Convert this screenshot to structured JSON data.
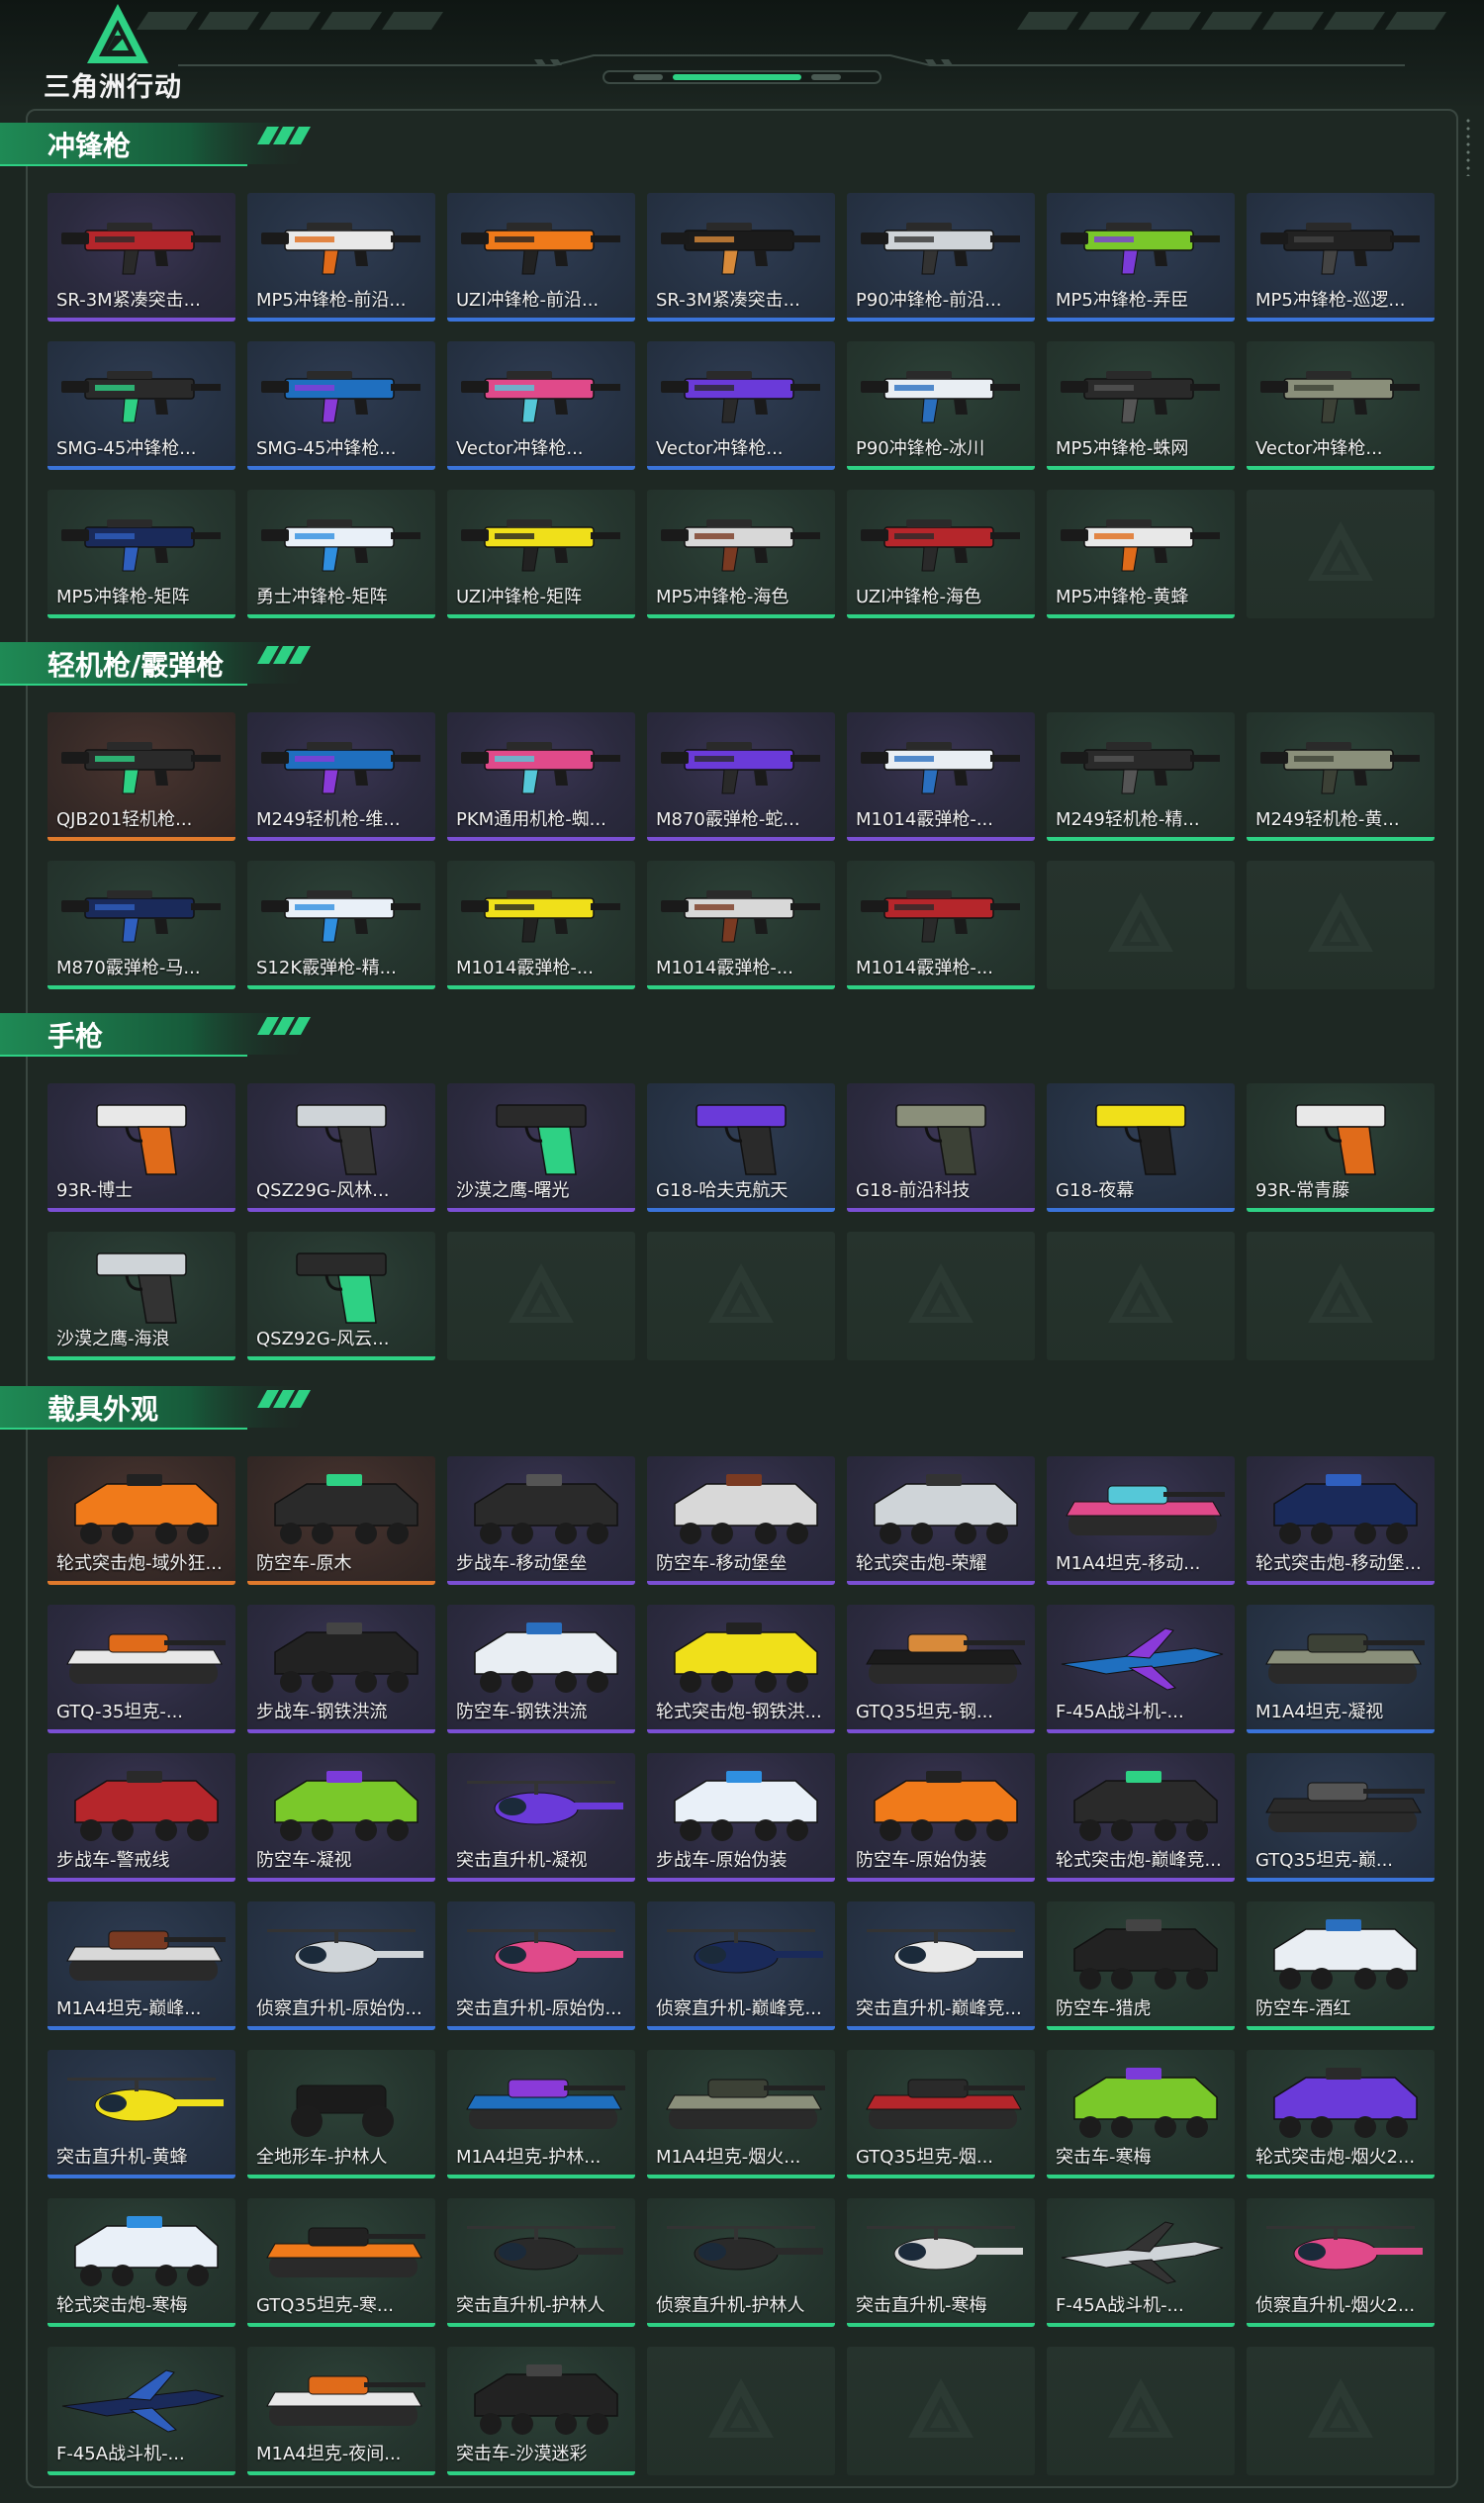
{
  "app": {
    "logo_text": "三角洲行动",
    "logo_icon": "triangle-delta-icon",
    "colors": {
      "accent_green": "#2ed184",
      "rarity_purple": "#7a4fd3",
      "rarity_blue": "#3a73d9",
      "rarity_green": "#2ed184",
      "rarity_orange": "#e07a2c"
    }
  },
  "sections": [
    {
      "title": "冲锋枪",
      "kind": "gun",
      "items": [
        {
          "label": "SR-3M紧凑突击...",
          "rarity": "purple"
        },
        {
          "label": "MP5冲锋枪-前沿...",
          "rarity": "blue"
        },
        {
          "label": "UZI冲锋枪-前沿...",
          "rarity": "blue"
        },
        {
          "label": "SR-3M紧凑突击...",
          "rarity": "blue"
        },
        {
          "label": "P90冲锋枪-前沿...",
          "rarity": "blue"
        },
        {
          "label": "MP5冲锋枪-弄臣",
          "rarity": "blue"
        },
        {
          "label": "MP5冲锋枪-巡逻...",
          "rarity": "blue"
        },
        {
          "label": "SMG-45冲锋枪...",
          "rarity": "blue"
        },
        {
          "label": "SMG-45冲锋枪...",
          "rarity": "blue"
        },
        {
          "label": "Vector冲锋枪...",
          "rarity": "blue"
        },
        {
          "label": "Vector冲锋枪...",
          "rarity": "blue"
        },
        {
          "label": "P90冲锋枪-冰川",
          "rarity": "green"
        },
        {
          "label": "MP5冲锋枪-蛛网",
          "rarity": "green"
        },
        {
          "label": "Vector冲锋枪...",
          "rarity": "green"
        },
        {
          "label": "MP5冲锋枪-矩阵",
          "rarity": "green"
        },
        {
          "label": "勇士冲锋枪-矩阵",
          "rarity": "green"
        },
        {
          "label": "UZI冲锋枪-矩阵",
          "rarity": "green"
        },
        {
          "label": "MP5冲锋枪-海色",
          "rarity": "green"
        },
        {
          "label": "UZI冲锋枪-海色",
          "rarity": "green"
        },
        {
          "label": "MP5冲锋枪-黄蜂",
          "rarity": "green"
        },
        {
          "label": "",
          "rarity": "empty"
        }
      ]
    },
    {
      "title": "轻机枪/霰弹枪",
      "kind": "gun",
      "items": [
        {
          "label": "QJB201轻机枪...",
          "rarity": "orange"
        },
        {
          "label": "M249轻机枪-维...",
          "rarity": "purple"
        },
        {
          "label": "PKM通用机枪-蜘...",
          "rarity": "purple"
        },
        {
          "label": "M870霰弹枪-蛇...",
          "rarity": "purple"
        },
        {
          "label": "M1014霰弹枪-...",
          "rarity": "purple"
        },
        {
          "label": "M249轻机枪-精...",
          "rarity": "green"
        },
        {
          "label": "M249轻机枪-黄...",
          "rarity": "green"
        },
        {
          "label": "M870霰弹枪-马...",
          "rarity": "green"
        },
        {
          "label": "S12K霰弹枪-精...",
          "rarity": "green"
        },
        {
          "label": "M1014霰弹枪-...",
          "rarity": "green"
        },
        {
          "label": "M1014霰弹枪-...",
          "rarity": "green"
        },
        {
          "label": "M1014霰弹枪-...",
          "rarity": "green"
        },
        {
          "label": "",
          "rarity": "empty"
        },
        {
          "label": "",
          "rarity": "empty"
        }
      ]
    },
    {
      "title": "手枪",
      "kind": "pistol",
      "items": [
        {
          "label": "93R-博士",
          "rarity": "purple"
        },
        {
          "label": "QSZ29G-风林...",
          "rarity": "purple"
        },
        {
          "label": "沙漠之鹰-曙光",
          "rarity": "purple"
        },
        {
          "label": "G18-哈夫克航天",
          "rarity": "blue"
        },
        {
          "label": "G18-前沿科技",
          "rarity": "purple"
        },
        {
          "label": "G18-夜幕",
          "rarity": "blue"
        },
        {
          "label": "93R-常青藤",
          "rarity": "green"
        },
        {
          "label": "沙漠之鹰-海浪",
          "rarity": "green"
        },
        {
          "label": "QSZ92G-风云...",
          "rarity": "green"
        },
        {
          "label": "",
          "rarity": "empty"
        },
        {
          "label": "",
          "rarity": "empty"
        },
        {
          "label": "",
          "rarity": "empty"
        },
        {
          "label": "",
          "rarity": "empty"
        },
        {
          "label": "",
          "rarity": "empty"
        }
      ]
    },
    {
      "title": "载具外观",
      "kind": "vehicle",
      "items": [
        {
          "label": "轮式突击炮-域外狂...",
          "rarity": "orange",
          "art": "apc"
        },
        {
          "label": "防空车-原木",
          "rarity": "orange",
          "art": "apc"
        },
        {
          "label": "步战车-移动堡垒",
          "rarity": "purple",
          "art": "apc"
        },
        {
          "label": "防空车-移动堡垒",
          "rarity": "purple",
          "art": "apc"
        },
        {
          "label": "轮式突击炮-荣耀",
          "rarity": "purple",
          "art": "apc"
        },
        {
          "label": "M1A4坦克-移动...",
          "rarity": "purple",
          "art": "tank"
        },
        {
          "label": "轮式突击炮-移动堡...",
          "rarity": "purple",
          "art": "apc"
        },
        {
          "label": "GTQ-35坦克-...",
          "rarity": "purple",
          "art": "tank"
        },
        {
          "label": "步战车-钢铁洪流",
          "rarity": "purple",
          "art": "apc"
        },
        {
          "label": "防空车-钢铁洪流",
          "rarity": "purple",
          "art": "apc"
        },
        {
          "label": "轮式突击炮-钢铁洪...",
          "rarity": "purple",
          "art": "apc"
        },
        {
          "label": "GTQ35坦克-钢...",
          "rarity": "purple",
          "art": "tank"
        },
        {
          "label": "F-45A战斗机-...",
          "rarity": "purple",
          "art": "jet"
        },
        {
          "label": "M1A4坦克-凝视",
          "rarity": "blue",
          "art": "tank"
        },
        {
          "label": "步战车-警戒线",
          "rarity": "purple",
          "art": "apc"
        },
        {
          "label": "防空车-凝视",
          "rarity": "purple",
          "art": "apc"
        },
        {
          "label": "突击直升机-凝视",
          "rarity": "purple",
          "art": "heli"
        },
        {
          "label": "步战车-原始伪装",
          "rarity": "purple",
          "art": "apc"
        },
        {
          "label": "防空车-原始伪装",
          "rarity": "purple",
          "art": "apc"
        },
        {
          "label": "轮式突击炮-巅峰竞...",
          "rarity": "purple",
          "art": "apc"
        },
        {
          "label": "GTQ35坦克-巅...",
          "rarity": "blue",
          "art": "tank"
        },
        {
          "label": "M1A4坦克-巅峰...",
          "rarity": "blue",
          "art": "tank"
        },
        {
          "label": "侦察直升机-原始伪...",
          "rarity": "blue",
          "art": "heli"
        },
        {
          "label": "突击直升机-原始伪...",
          "rarity": "blue",
          "art": "heli"
        },
        {
          "label": "侦察直升机-巅峰竞...",
          "rarity": "blue",
          "art": "heli"
        },
        {
          "label": "突击直升机-巅峰竞...",
          "rarity": "blue",
          "art": "heli"
        },
        {
          "label": "防空车-猎虎",
          "rarity": "green",
          "art": "apc"
        },
        {
          "label": "防空车-酒红",
          "rarity": "green",
          "art": "apc"
        },
        {
          "label": "突击直升机-黄蜂",
          "rarity": "blue",
          "art": "heli"
        },
        {
          "label": "全地形车-护林人",
          "rarity": "green",
          "art": "atv"
        },
        {
          "label": "M1A4坦克-护林...",
          "rarity": "green",
          "art": "tank"
        },
        {
          "label": "M1A4坦克-烟火...",
          "rarity": "green",
          "art": "tank"
        },
        {
          "label": "GTQ35坦克-烟...",
          "rarity": "green",
          "art": "tank"
        },
        {
          "label": "突击车-寒梅",
          "rarity": "green",
          "art": "apc"
        },
        {
          "label": "轮式突击炮-烟火2...",
          "rarity": "green",
          "art": "apc"
        },
        {
          "label": "轮式突击炮-寒梅",
          "rarity": "green",
          "art": "apc"
        },
        {
          "label": "GTQ35坦克-寒...",
          "rarity": "green",
          "art": "tank"
        },
        {
          "label": "突击直升机-护林人",
          "rarity": "green",
          "art": "heli"
        },
        {
          "label": "侦察直升机-护林人",
          "rarity": "green",
          "art": "heli"
        },
        {
          "label": "突击直升机-寒梅",
          "rarity": "green",
          "art": "heli"
        },
        {
          "label": "F-45A战斗机-...",
          "rarity": "green",
          "art": "jet"
        },
        {
          "label": "侦察直升机-烟火2...",
          "rarity": "green",
          "art": "heli"
        },
        {
          "label": "F-45A战斗机-...",
          "rarity": "green",
          "art": "jet"
        },
        {
          "label": "M1A4坦克-夜间...",
          "rarity": "green",
          "art": "tank"
        },
        {
          "label": "突击车-沙漠迷彩",
          "rarity": "green",
          "art": "apc"
        },
        {
          "label": "",
          "rarity": "empty"
        },
        {
          "label": "",
          "rarity": "empty"
        },
        {
          "label": "",
          "rarity": "empty"
        },
        {
          "label": "",
          "rarity": "empty"
        }
      ]
    }
  ]
}
